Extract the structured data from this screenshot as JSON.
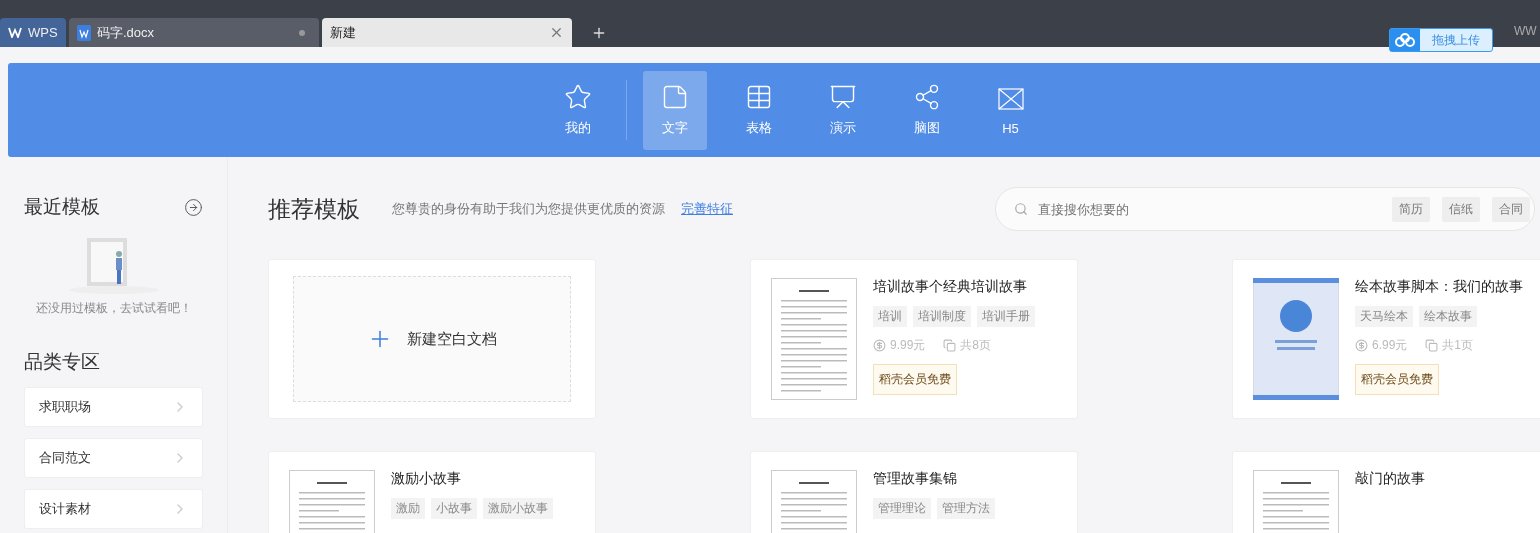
{
  "tabs": [
    {
      "kind": "home",
      "label": "WPS",
      "selected": false,
      "modified": false
    },
    {
      "kind": "doc",
      "label": "码字.docx",
      "selected": false,
      "modified": true
    },
    {
      "kind": "new",
      "label": "新建",
      "selected": true,
      "modified": false
    }
  ],
  "upload_button": {
    "label": "拖拽上传"
  },
  "corner_text": "WW",
  "categories": [
    {
      "label": "我的",
      "selected": false
    },
    {
      "label": "文字",
      "selected": true
    },
    {
      "label": "表格",
      "selected": false
    },
    {
      "label": "演示",
      "selected": false
    },
    {
      "label": "脑图",
      "selected": false
    },
    {
      "label": "H5",
      "selected": false
    }
  ],
  "sidebar": {
    "recent_title": "最近模板",
    "recent_empty": "还没用过模板，去试试看吧！",
    "zone_title": "品类专区",
    "items": [
      "求职职场",
      "合同范文",
      "设计素材"
    ]
  },
  "main": {
    "title": "推荐模板",
    "subtitle": "您尊贵的身份有助于我们为您提供更优质的资源",
    "link": "完善特征",
    "search": {
      "placeholder": "直接搜你想要的",
      "hot_tags": [
        "简历",
        "信纸",
        "合同"
      ]
    },
    "cards": [
      {
        "kind": "blank",
        "title": "新建空白文档"
      },
      {
        "kind": "document",
        "title": "培训故事个经典培训故事",
        "tags": [
          "培训",
          "培训制度",
          "培训手册"
        ],
        "price": "9.99元",
        "pages": "共8页",
        "badge": "稻壳会员免费"
      },
      {
        "kind": "cover",
        "title": "绘本故事脚本：我们的故事",
        "tags": [
          "天马绘本",
          "绘本故事"
        ],
        "price": "6.99元",
        "pages": "共1页",
        "badge": "稻壳会员免费"
      },
      {
        "kind": "document",
        "title": "激励小故事",
        "tags": [
          "激励",
          "小故事",
          "激励小故事"
        ]
      },
      {
        "kind": "document",
        "title": "管理故事集锦",
        "tags": [
          "管理理论",
          "管理方法"
        ]
      },
      {
        "kind": "document",
        "title": "敲门的故事"
      }
    ]
  }
}
